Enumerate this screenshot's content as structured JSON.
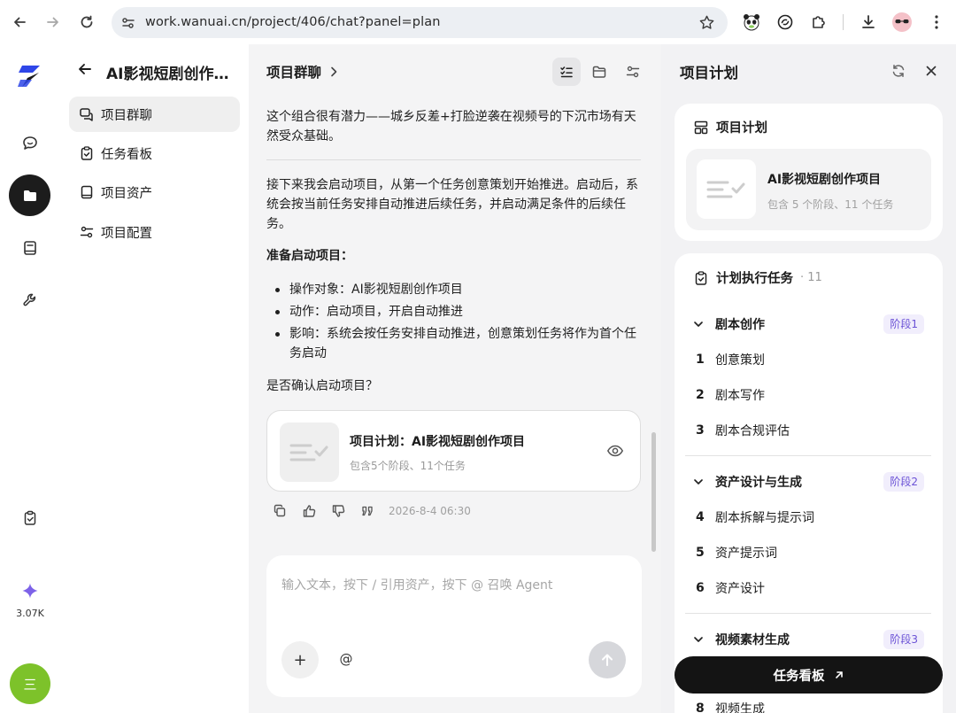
{
  "browser": {
    "url": "work.wanuai.cn/project/406/chat?panel=plan"
  },
  "rail": {
    "credits": "3.07K",
    "avatar_text": "三"
  },
  "project": {
    "title": "AI影视短剧创作…",
    "nav": [
      {
        "label": "项目群聊",
        "icon": "chat-icon",
        "active": true
      },
      {
        "label": "任务看板",
        "icon": "clipboard-check-icon",
        "active": false
      },
      {
        "label": "项目资产",
        "icon": "book-icon",
        "active": false
      },
      {
        "label": "项目配置",
        "icon": "sliders-icon",
        "active": false
      }
    ]
  },
  "chat": {
    "title": "项目群聊",
    "intro": "这个组合很有潜力——城乡反差+打脸逆袭在视频号的下沉市场有天然受众基础。",
    "body": "接下来我会启动项目，从第一个任务创意策划开始推进。启动后，系统会按当前任务安排自动推进后续任务，并启动满足条件的后续任务。",
    "prep_title": "准备启动项目：",
    "bullets": [
      "操作对象：AI影视短剧创作项目",
      "动作：启动项目，开启自动推进",
      "影响：系统会按任务安排自动推进，创意策划任务将作为首个任务启动"
    ],
    "confirm": "是否确认启动项目？",
    "card": {
      "title": "项目计划：AI影视短剧创作项目",
      "subtitle": "包含5个阶段、11个任务"
    },
    "timestamp": "2026-8-4 06:30",
    "composer": {
      "placeholder": "输入文本，按下 / 引用资产，按下 @ 召唤 Agent",
      "at_label": "@",
      "plus_label": "+"
    }
  },
  "panel": {
    "title": "项目计划",
    "plan_header": "项目计划",
    "plan_name": "AI影视短剧创作项目",
    "plan_sub": "包含 5 个阶段、11 个任务",
    "tasks_header": "计划执行任务",
    "tasks_count": "· 11",
    "stages": [
      {
        "name": "剧本创作",
        "badge": "阶段1",
        "tasks": [
          {
            "num": "1",
            "name": "创意策划"
          },
          {
            "num": "2",
            "name": "剧本写作"
          },
          {
            "num": "3",
            "name": "剧本合规评估"
          }
        ]
      },
      {
        "name": "资产设计与生成",
        "badge": "阶段2",
        "tasks": [
          {
            "num": "4",
            "name": "剧本拆解与提示词"
          },
          {
            "num": "5",
            "name": "资产提示词"
          },
          {
            "num": "6",
            "name": "资产设计"
          }
        ]
      },
      {
        "name": "视频素材生成",
        "badge": "阶段3",
        "tasks": [
          {
            "num": "8",
            "name": "视频生成"
          }
        ]
      }
    ],
    "board_button": "任务看板"
  }
}
